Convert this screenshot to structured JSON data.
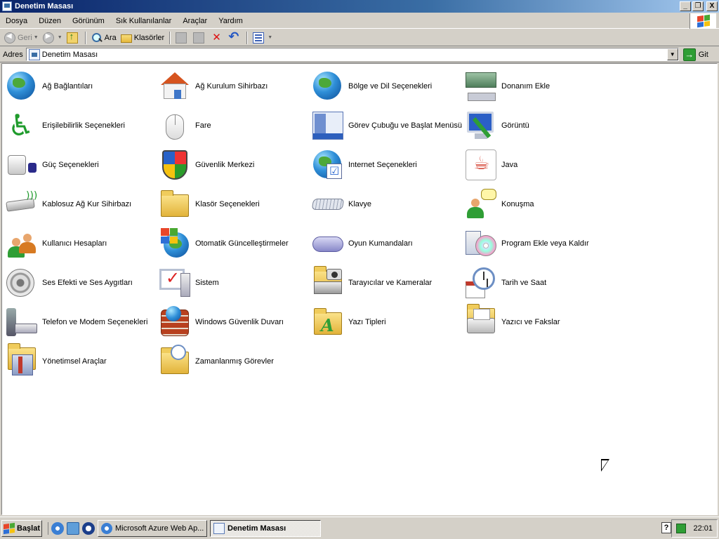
{
  "window": {
    "title": "Denetim Masası"
  },
  "title_buttons": {
    "minimize": "_",
    "restore": "❐",
    "close": "X"
  },
  "menu": [
    "Dosya",
    "Düzen",
    "Görünüm",
    "Sık Kullanılanlar",
    "Araçlar",
    "Yardım"
  ],
  "toolbar": {
    "back": "Geri",
    "search": "Ara",
    "folders": "Klasörler"
  },
  "address": {
    "label": "Adres",
    "value": "Denetim Masası",
    "go": "Git"
  },
  "items": [
    {
      "label": "Ağ Bağlantıları",
      "icon": "network-connections-icon"
    },
    {
      "label": "Ağ Kurulum Sihirbazı",
      "icon": "network-setup-wizard-icon"
    },
    {
      "label": "Bölge ve Dil Seçenekleri",
      "icon": "regional-language-icon"
    },
    {
      "label": "Donanım Ekle",
      "icon": "add-hardware-icon"
    },
    {
      "label": "Erişilebilirlik Seçenekleri",
      "icon": "accessibility-icon"
    },
    {
      "label": "Fare",
      "icon": "mouse-icon"
    },
    {
      "label": "Görev Çubuğu ve Başlat Menüsü",
      "icon": "taskbar-start-menu-icon"
    },
    {
      "label": "Görüntü",
      "icon": "display-icon"
    },
    {
      "label": "Güç Seçenekleri",
      "icon": "power-options-icon"
    },
    {
      "label": "Güvenlik Merkezi",
      "icon": "security-center-icon"
    },
    {
      "label": "Internet Seçenekleri",
      "icon": "internet-options-icon"
    },
    {
      "label": "Java",
      "icon": "java-icon"
    },
    {
      "label": "Kablosuz Ağ Kur Sihirbazı",
      "icon": "wireless-network-wizard-icon"
    },
    {
      "label": "Klasör Seçenekleri",
      "icon": "folder-options-icon"
    },
    {
      "label": "Klavye",
      "icon": "keyboard-icon"
    },
    {
      "label": "Konuşma",
      "icon": "speech-icon"
    },
    {
      "label": "Kullanıcı Hesapları",
      "icon": "user-accounts-icon"
    },
    {
      "label": "Otomatik Güncelleştirmeler",
      "icon": "automatic-updates-icon"
    },
    {
      "label": "Oyun Kumandaları",
      "icon": "game-controllers-icon"
    },
    {
      "label": "Program Ekle veya Kaldır",
      "icon": "add-remove-programs-icon"
    },
    {
      "label": "Ses Efekti ve Ses Aygıtları",
      "icon": "sounds-audio-icon"
    },
    {
      "label": "Sistem",
      "icon": "system-icon"
    },
    {
      "label": "Tarayıcılar ve Kameralar",
      "icon": "scanners-cameras-icon"
    },
    {
      "label": "Tarih ve Saat",
      "icon": "date-time-icon"
    },
    {
      "label": "Telefon ve Modem Seçenekleri",
      "icon": "phone-modem-icon"
    },
    {
      "label": "Windows Güvenlik Duvarı",
      "icon": "windows-firewall-icon"
    },
    {
      "label": "Yazı Tipleri",
      "icon": "fonts-icon"
    },
    {
      "label": "Yazıcı ve Fakslar",
      "icon": "printers-faxes-icon"
    },
    {
      "label": "Yönetimsel Araçlar",
      "icon": "administrative-tools-icon"
    },
    {
      "label": "Zamanlanmış Görevler",
      "icon": "scheduled-tasks-icon"
    }
  ],
  "taskbar": {
    "start": "Başlat",
    "tasks": [
      {
        "label": "Microsoft Azure Web Ap...",
        "active": false
      },
      {
        "label": "Denetim Masası",
        "active": true
      }
    ],
    "clock": "22:01",
    "help": "?"
  },
  "colors": {
    "title_gradient_start": "#0a246a",
    "title_gradient_end": "#a6caf0",
    "chrome": "#d4d0c8",
    "content_bg": "#ffffff"
  }
}
